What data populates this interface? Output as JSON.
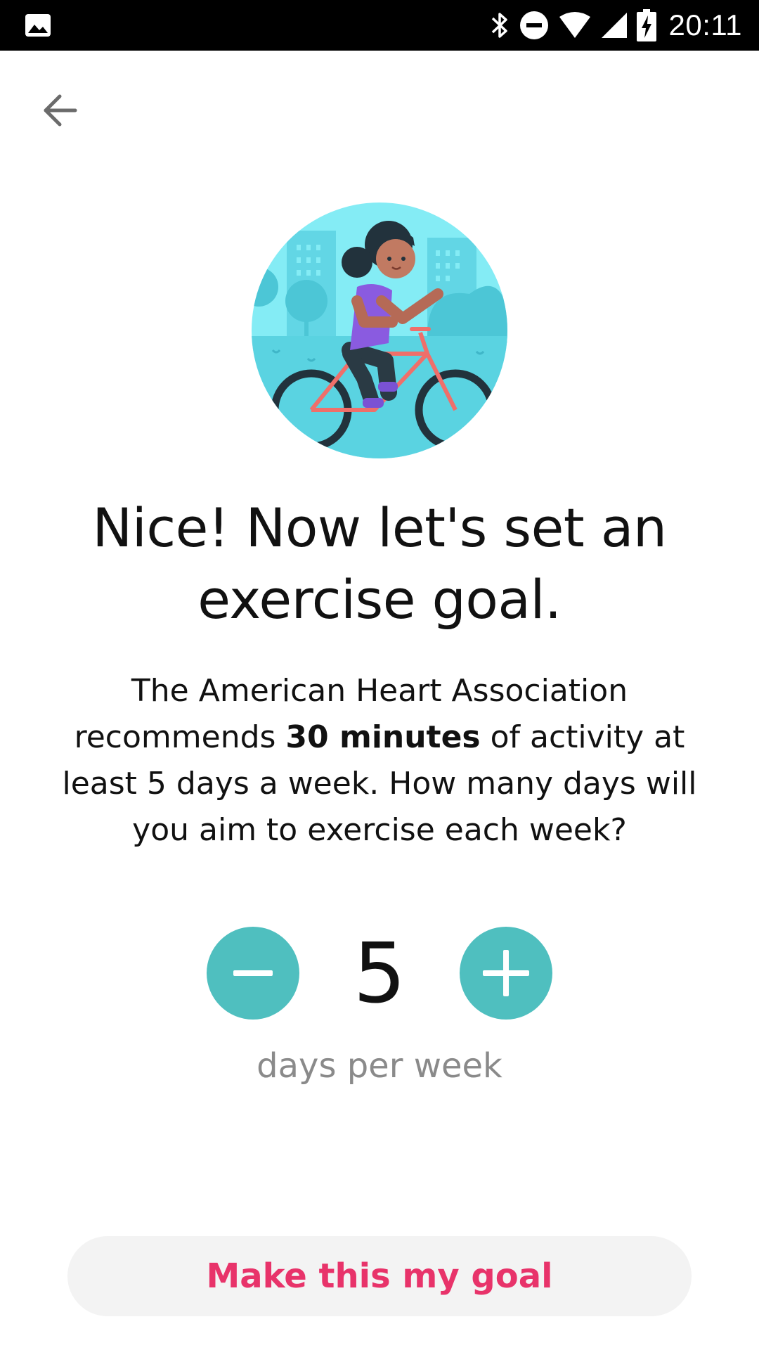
{
  "status_bar": {
    "time": "20:11",
    "icons": [
      "gallery-icon",
      "bluetooth-icon",
      "do-not-disturb-icon",
      "wifi-icon",
      "cellular-signal-icon",
      "battery-charging-icon"
    ]
  },
  "nav": {
    "back_icon": "arrow-left-icon"
  },
  "illustration": {
    "subject": "cyclist-illustration"
  },
  "headline": "Nice! Now let's set an exercise goal.",
  "body": {
    "before": "The American Heart Association recommends ",
    "emphasis": "30 minutes",
    "after": " of activity at least 5 days a week. How many days will you aim to exercise each week?"
  },
  "stepper": {
    "value": "5",
    "unit": "days per week",
    "decrement_icon": "minus-icon",
    "increment_icon": "plus-icon"
  },
  "primary_action": {
    "label": "Make this my goal"
  },
  "colors": {
    "accent_teal": "#4fbfbf",
    "action_pink": "#e8336a",
    "button_bg": "#f3f3f3"
  }
}
